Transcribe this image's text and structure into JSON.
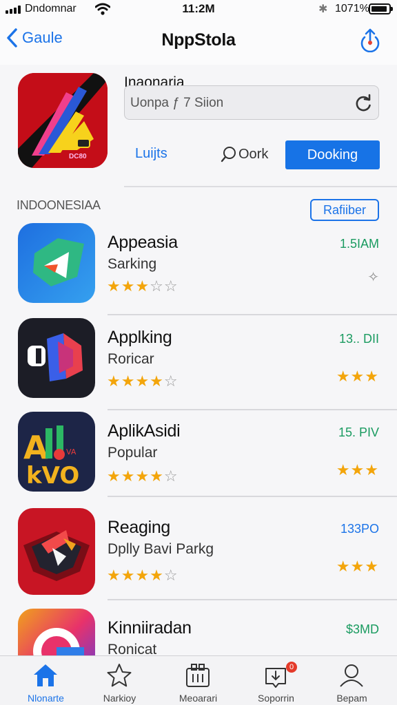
{
  "status": {
    "carrier": "Dndomnar",
    "time": "11:2M",
    "battery": "1071%"
  },
  "nav": {
    "back_label": "Gaule",
    "title": "NppStola"
  },
  "featured": {
    "title": "Inaonaria",
    "search_value": "Uonpa ƒ 7 Siion",
    "icon_text": "DC80",
    "buttons": [
      "Luijts",
      "Oork",
      "Dooking"
    ]
  },
  "section": {
    "title": "INDOONESIAA",
    "button": "Rafiiber"
  },
  "apps": [
    {
      "name": "Appeasia",
      "subtitle": "Sarking",
      "rating": 3,
      "meta": "1.5IAM",
      "meta_color": "#1a9b60",
      "right": "pin-icon"
    },
    {
      "name": "Applking",
      "subtitle": "Roricar",
      "rating": 4,
      "meta": "13.. DII",
      "meta_color": "#1a9b60",
      "right": "stars"
    },
    {
      "name": "AplikAsidi",
      "subtitle": "Popular",
      "rating": 4,
      "meta": "15. PIV",
      "meta_color": "#1a9b60",
      "right": "stars"
    },
    {
      "name": "Reaging",
      "subtitle": "Dplly Bavi Parkg",
      "rating": 4,
      "meta": "133PO",
      "meta_color": "#1b73e8",
      "right": "stars"
    },
    {
      "name": "Kinniiradan",
      "subtitle": "Ronicat",
      "rating": 0,
      "meta": "$3MD",
      "meta_color": "#1a9b60",
      "right": "none"
    }
  ],
  "tabs": [
    {
      "label": "Nlonarte",
      "icon": "home-icon",
      "active": true
    },
    {
      "label": "Narkioy",
      "icon": "star-icon",
      "active": false
    },
    {
      "label": "Meoarari",
      "icon": "apps-icon",
      "active": false
    },
    {
      "label": "Soporrin",
      "icon": "download-icon",
      "active": false,
      "badge": "0"
    },
    {
      "label": "Bepam",
      "icon": "person-icon",
      "active": false
    }
  ]
}
